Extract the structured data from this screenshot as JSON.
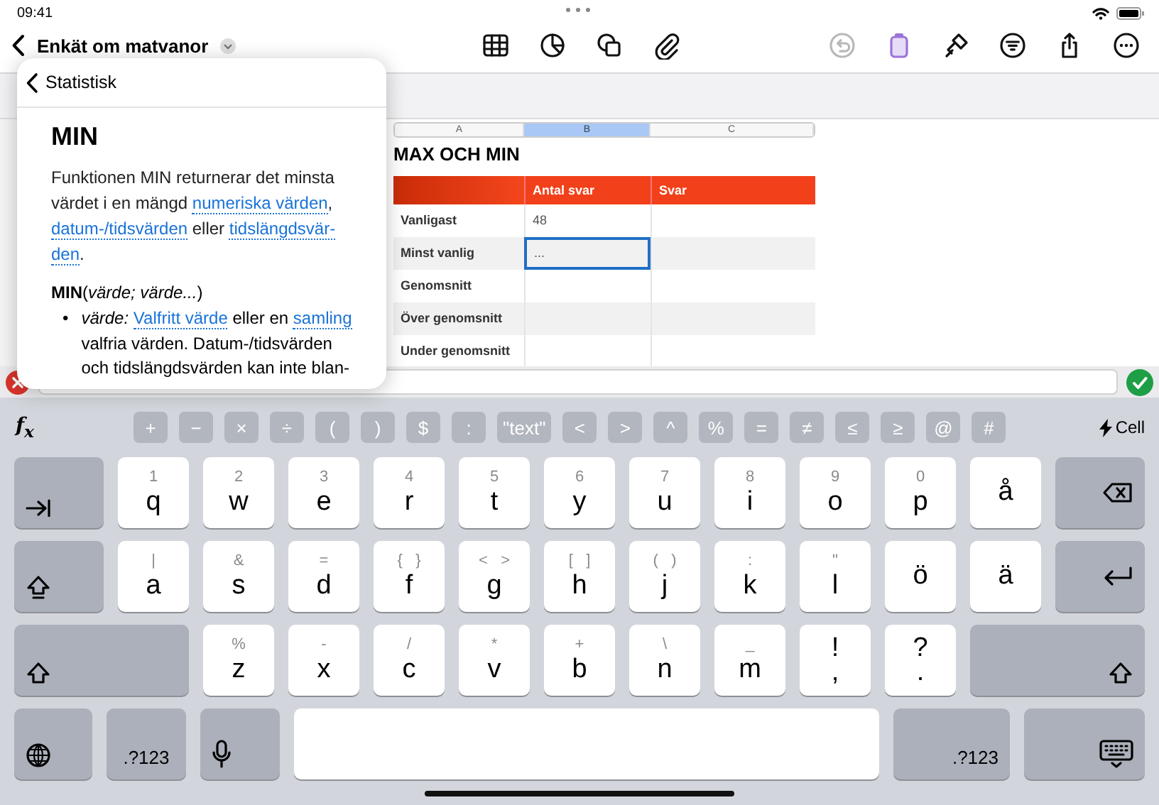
{
  "status_bar": {
    "time": "09:41"
  },
  "document": {
    "title": "Enkät om matvanor"
  },
  "toolbar": [
    {
      "kind": "table",
      "disabled": false,
      "selected": false
    },
    {
      "kind": "chart",
      "disabled": false,
      "selected": false
    },
    {
      "kind": "shapes",
      "disabled": false,
      "selected": false
    },
    {
      "kind": "attach",
      "disabled": false,
      "selected": false
    },
    {
      "kind": "undo",
      "disabled": true,
      "selected": false
    },
    {
      "kind": "format",
      "disabled": false,
      "selected": true
    },
    {
      "kind": "brush",
      "disabled": false,
      "selected": false
    },
    {
      "kind": "filter",
      "disabled": false,
      "selected": false
    },
    {
      "kind": "share",
      "disabled": false,
      "selected": false
    },
    {
      "kind": "more",
      "disabled": false,
      "selected": false
    }
  ],
  "popover": {
    "back_label": "Statistisk",
    "title": "MIN",
    "description": [
      {
        "kind": "text",
        "text": "Funktionen MIN returnerar det minsta värdet i en mängd "
      },
      {
        "kind": "link",
        "text": "numeriska värden"
      },
      {
        "kind": "text",
        "text": ", "
      },
      {
        "kind": "link",
        "text": "datum-/tidsvärden"
      },
      {
        "kind": "text",
        "text": " eller "
      },
      {
        "kind": "link",
        "text": "tidslängdsvär-"
      },
      {
        "kind": "link",
        "text": "den"
      },
      {
        "kind": "text",
        "text": "."
      }
    ],
    "syntax": "**MIN**(*värde; värde...*)",
    "arguments": [
      {
        "marker": "•",
        "segments": [
          {
            "kind": "text",
            "text": "*värde:* "
          },
          {
            "kind": "link",
            "text": "Valfritt värde"
          },
          {
            "kind": "text",
            "text": " eller en "
          },
          {
            "kind": "link",
            "text": "samling"
          },
          {
            "kind": "text",
            "text": " valfria värden. Datum-/tidsvärden och tidslängdsvärden kan inte blan-"
          }
        ]
      }
    ]
  },
  "sheet": {
    "columns": [
      {
        "label": "A",
        "selected": false
      },
      {
        "label": "B",
        "selected": true
      },
      {
        "label": "C",
        "selected": false
      }
    ],
    "title": "MAX OCH MIN",
    "header": [
      "Antal svar",
      "Svar"
    ],
    "rows": [
      {
        "label": "Vanligast",
        "cells": [
          {
            "value": "48",
            "selected": false
          },
          {
            "selected": false
          }
        ]
      },
      {
        "label": "Minst vanlig",
        "cells": [
          {
            "value": "...",
            "selected": true
          },
          {
            "selected": false
          }
        ]
      },
      {
        "label": "Genomsnitt",
        "cells": [
          {
            "selected": false
          },
          {
            "selected": false
          }
        ]
      },
      {
        "label": "Över genomsnitt",
        "cells": [
          {
            "selected": false
          },
          {
            "selected": false
          }
        ]
      },
      {
        "label": "Under genomsnitt",
        "cells": [
          {
            "selected": false
          },
          {
            "selected": false
          }
        ]
      }
    ]
  },
  "keyboard": {
    "fx_label": "f$_{x}$",
    "cell_label": "Cell",
    "symbols": [
      "+",
      "−",
      "×",
      "÷",
      "(",
      ")",
      "$",
      ":",
      "\"text\"",
      "<",
      ">",
      "^",
      "%",
      "=",
      "≠",
      "≤",
      "≥",
      "@",
      "#"
    ],
    "rows": [
      {
        "keys": [
          {
            "kind": "tab"
          },
          {
            "kind": "letter",
            "label": "q",
            "hint": "1"
          },
          {
            "kind": "letter",
            "label": "w",
            "hint": "2"
          },
          {
            "kind": "letter",
            "label": "e",
            "hint": "3"
          },
          {
            "kind": "letter",
            "label": "r",
            "hint": "4"
          },
          {
            "kind": "letter",
            "label": "t",
            "hint": "5"
          },
          {
            "kind": "letter",
            "label": "y",
            "hint": "6"
          },
          {
            "kind": "letter",
            "label": "u",
            "hint": "7"
          },
          {
            "kind": "letter",
            "label": "i",
            "hint": "8"
          },
          {
            "kind": "letter",
            "label": "o",
            "hint": "9"
          },
          {
            "kind": "letter",
            "label": "p",
            "hint": "0"
          },
          {
            "kind": "letter",
            "label": "å"
          },
          {
            "kind": "backspace"
          }
        ]
      },
      {
        "keys": [
          {
            "kind": "caps"
          },
          {
            "kind": "letter",
            "label": "a",
            "hint": "|"
          },
          {
            "kind": "letter",
            "label": "s",
            "hint": "&"
          },
          {
            "kind": "letter",
            "label": "d",
            "hint": "="
          },
          {
            "kind": "letter",
            "label": "f",
            "hint": "{   }"
          },
          {
            "kind": "letter",
            "label": "g",
            "hint": "<   >"
          },
          {
            "kind": "letter",
            "label": "h",
            "hint": "[   ]"
          },
          {
            "kind": "letter",
            "label": "j",
            "hint": "(   )"
          },
          {
            "kind": "letter",
            "label": "k",
            "hint": ":"
          },
          {
            "kind": "letter",
            "label": "l",
            "hint": "\""
          },
          {
            "kind": "letter",
            "label": "ö"
          },
          {
            "kind": "letter",
            "label": "ä"
          },
          {
            "kind": "return"
          }
        ]
      },
      {
        "keys": [
          {
            "kind": "shift"
          },
          {
            "kind": "letter",
            "label": "z",
            "hint": "%"
          },
          {
            "kind": "letter",
            "label": "x",
            "hint": "-"
          },
          {
            "kind": "letter",
            "label": "c",
            "hint": "/"
          },
          {
            "kind": "letter",
            "label": "v",
            "hint": "*"
          },
          {
            "kind": "letter",
            "label": "b",
            "hint": "+"
          },
          {
            "kind": "letter",
            "label": "n",
            "hint": "\\"
          },
          {
            "kind": "letter",
            "label": "m",
            "hint": "_"
          },
          {
            "kind": "punct",
            "label": ",",
            "hint": "!"
          },
          {
            "kind": "punct",
            "label": ".",
            "hint": "?"
          },
          {
            "kind": "shift"
          }
        ]
      },
      {
        "keys": [
          {
            "kind": "globe"
          },
          {
            "kind": "numbers",
            "label": ".?123"
          },
          {
            "kind": "mic"
          },
          {
            "kind": "space"
          },
          {
            "kind": "numbers",
            "label": ".?123"
          },
          {
            "kind": "hide"
          }
        ]
      }
    ]
  }
}
